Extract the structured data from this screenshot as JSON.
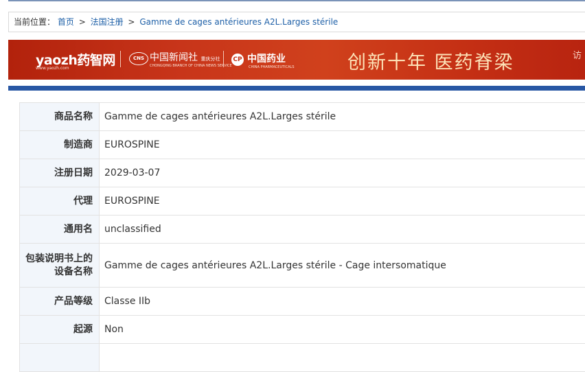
{
  "breadcrumb": {
    "prefix": "当前位置：",
    "items": [
      "首页",
      "法国注册"
    ],
    "separator": ">",
    "current": "Gamme de cages antérieures A2L.Larges stérile"
  },
  "banner": {
    "logo": "yaozh药智网",
    "logo_sub": "www.yaozh.com",
    "cns_badge": "CNS",
    "cns_name": "中国新闻社",
    "cns_branch": "重庆分社",
    "cns_sub": "CHONGQING BRANCH OF CHINA NEWS SERVICE",
    "cp_icon": "CP",
    "cp_name": "中国药业",
    "cp_sub": "CHINA PHARMACEUTICALS",
    "slogan": "创新十年  医药脊梁",
    "slogan_tail": "访"
  },
  "details": {
    "rows": [
      {
        "label": "商品名称",
        "value": "Gamme de cages antérieures A2L.Larges stérile"
      },
      {
        "label": "制造商",
        "value": "EUROSPINE"
      },
      {
        "label": "注册日期",
        "value": "2029-03-07"
      },
      {
        "label": "代理",
        "value": "EUROSPINE"
      },
      {
        "label": "通用名",
        "value": "unclassified"
      },
      {
        "label": "包装说明书上的设备名称",
        "value": "Gamme de cages antérieures A2L.Larges stérile - Cage intersomatique"
      },
      {
        "label": "产品等级",
        "value": "Classe IIb"
      },
      {
        "label": "起源",
        "value": "Non"
      }
    ]
  }
}
